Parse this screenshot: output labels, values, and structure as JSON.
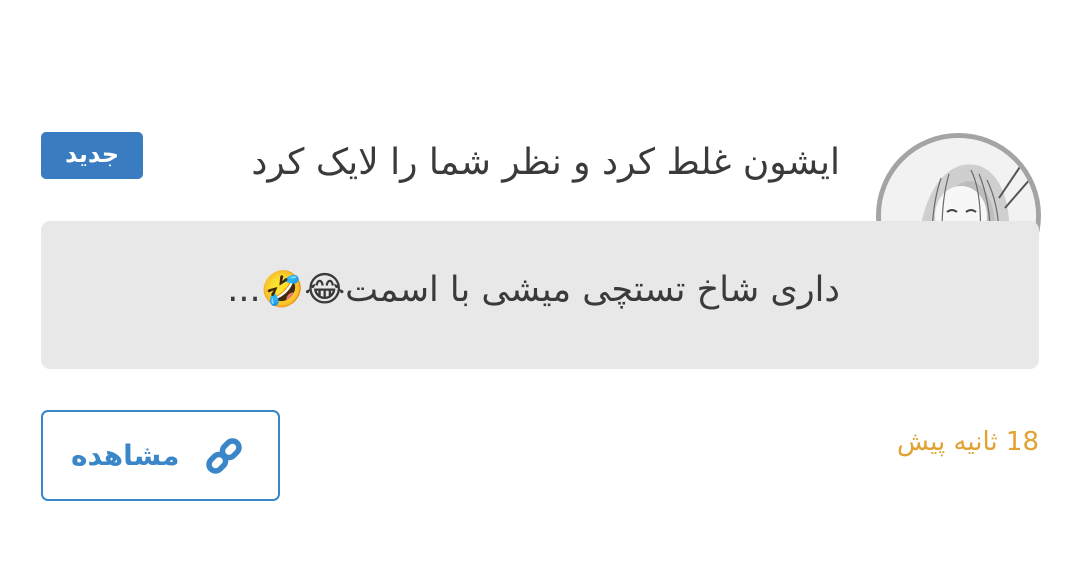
{
  "notification": {
    "title": "ایشون غلط کرد و نظر شما را لایک کرد",
    "badge": "جدید",
    "message": "داری شاخ تستچی میشی با اسمت😂🤣...",
    "time": "18 ثانیه پیش",
    "view_label": "مشاهده"
  },
  "colors": {
    "badge_bg": "#3a7cc1",
    "time_text": "#e0a231",
    "button_accent": "#3a86c8",
    "message_bg": "#e8e8e8"
  },
  "icons": {
    "view": "link-icon",
    "avatar": "user-avatar"
  }
}
